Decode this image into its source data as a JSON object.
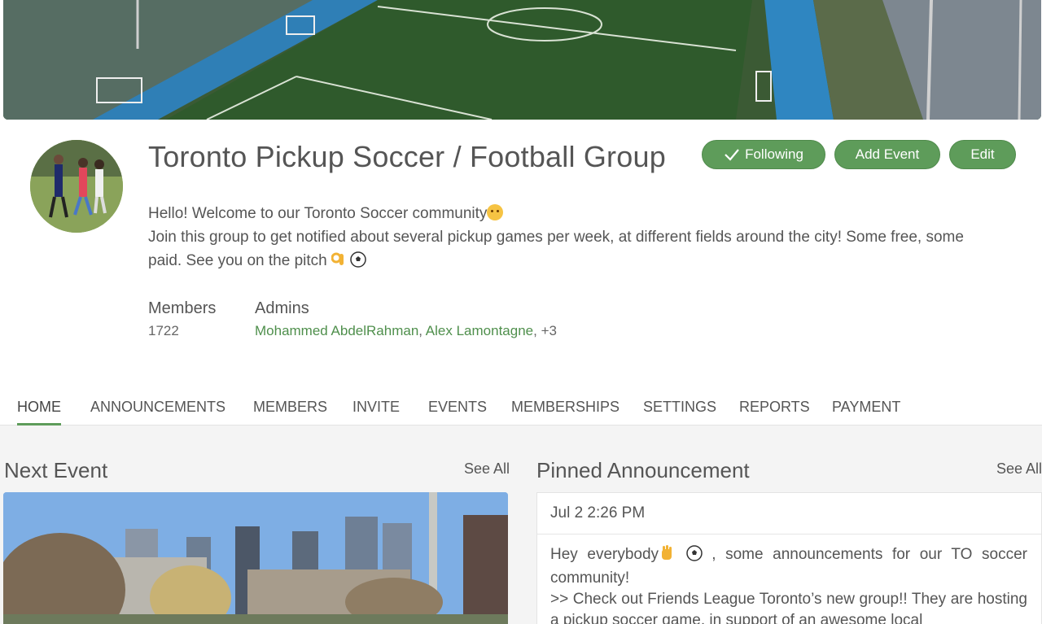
{
  "group": {
    "title": "Toronto Pickup Soccer / Football Group",
    "description_line1": "Hello! Welcome to our Toronto Soccer community",
    "description_line2": "Join this group to get notified about several pickup games per week, at different fields around the city! Some free, some paid. See you on the pitch",
    "emoji_icons": [
      "hugging-face-icon",
      "ok-hand-icon",
      "soccer-ball-icon"
    ]
  },
  "actions": {
    "following_label": "Following",
    "add_event_label": "Add Event",
    "edit_label": "Edit"
  },
  "stats": {
    "members_label": "Members",
    "members_value": "1722",
    "admins_label": "Admins",
    "admin1": "Mohammed AbdelRahman",
    "admin2": "Alex Lamontagne",
    "admins_more": "+3"
  },
  "tabs": [
    {
      "label": "HOME",
      "active": true
    },
    {
      "label": "ANNOUNCEMENTS"
    },
    {
      "label": "MEMBERS"
    },
    {
      "label": "INVITE"
    },
    {
      "label": "EVENTS"
    },
    {
      "label": "MEMBERSHIPS"
    },
    {
      "label": "SETTINGS"
    },
    {
      "label": "REPORTS"
    },
    {
      "label": "PAYMENT"
    }
  ],
  "next_event": {
    "title": "Next Event",
    "see_all": "See All"
  },
  "pinned": {
    "title": "Pinned Announcement",
    "see_all": "See All",
    "date": "Jul 2 2:26 PM",
    "body_line1_a": "Hey everybody",
    "body_line1_b": ", some announcements for our TO soccer community!",
    "body_line2": ">> Check out Friends League Toronto’s new group!! They are hosting a pickup soccer game, in support of an awesome local"
  },
  "colors": {
    "accent": "#5e9c5a",
    "link": "#4f8f4c",
    "lower_bg": "#f4f4f4"
  }
}
